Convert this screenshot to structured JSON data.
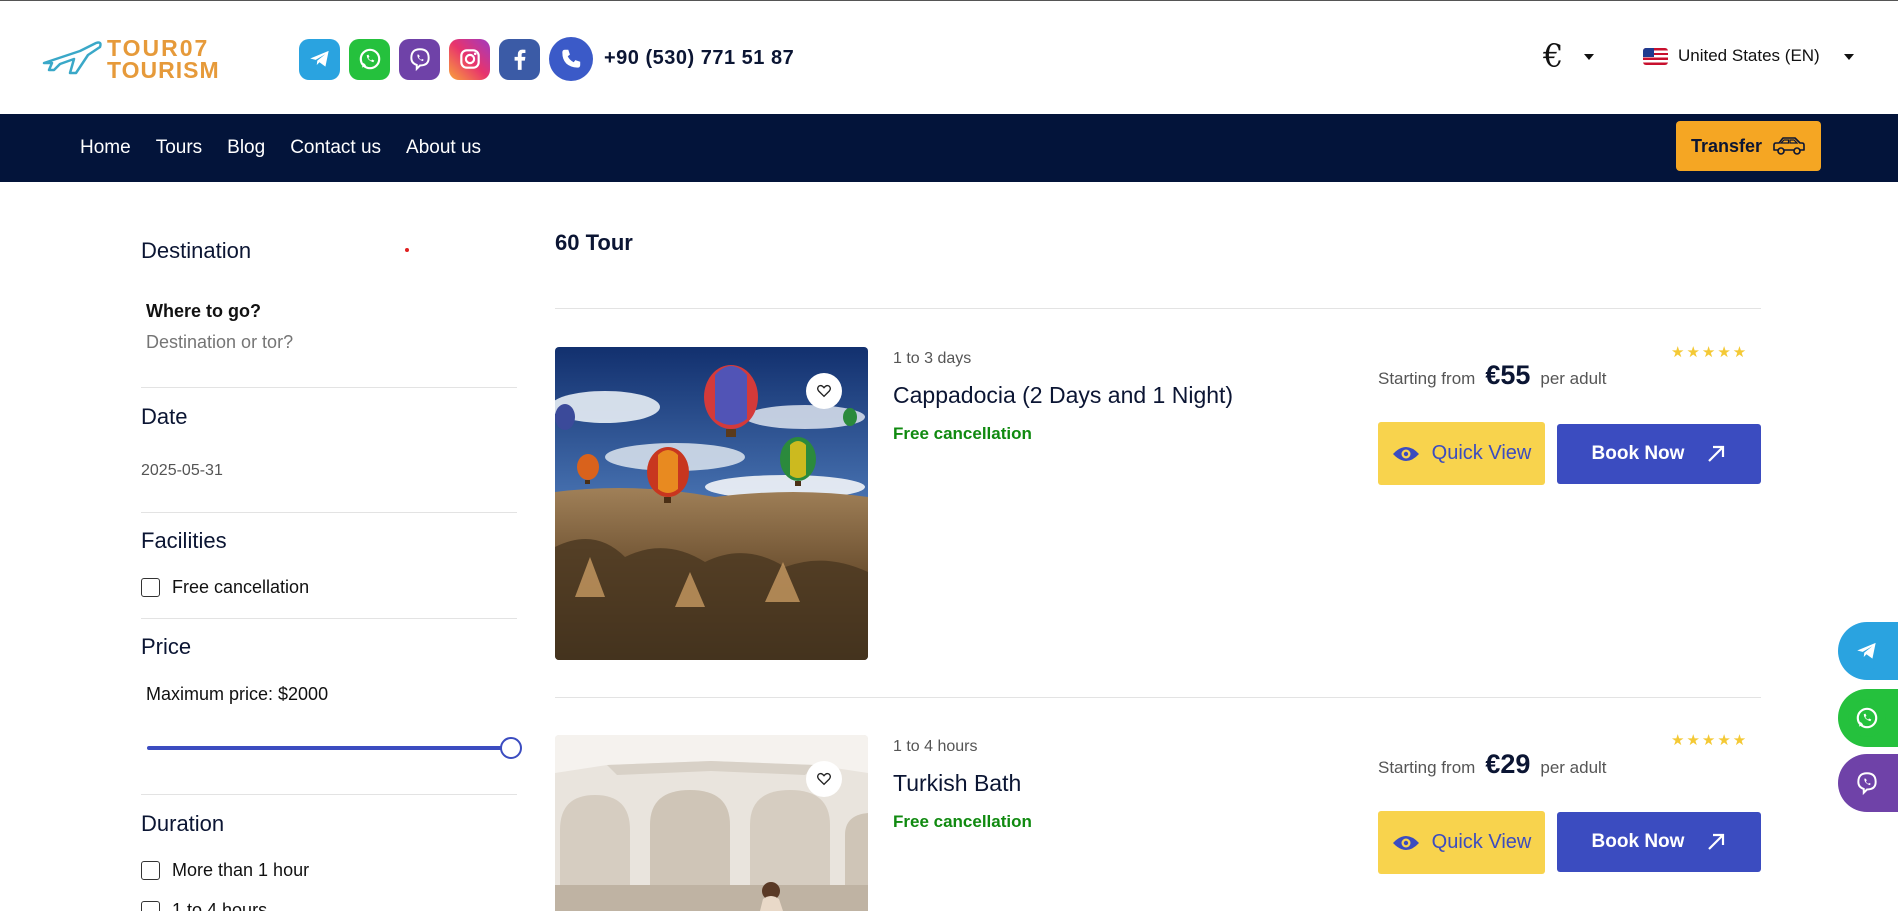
{
  "header": {
    "logo_line1": "TOUR07",
    "logo_line2": "TOURISM",
    "phone": "+90 (530) 771 51 87",
    "currency": "€",
    "language": "United States (EN)"
  },
  "social_icons": [
    "telegram-icon",
    "whatsapp-icon",
    "viber-icon",
    "instagram-icon",
    "facebook-icon",
    "phone-icon"
  ],
  "nav": {
    "links": [
      "Home",
      "Tours",
      "Blog",
      "Contact us",
      "About us"
    ],
    "transfer_label": "Transfer"
  },
  "filters": {
    "destination": {
      "title": "Destination",
      "label": "Where to go?",
      "placeholder": "Destination or tor?"
    },
    "date": {
      "title": "Date",
      "value": "2025-05-31"
    },
    "facilities": {
      "title": "Facilities",
      "options": [
        "Free cancellation"
      ]
    },
    "price": {
      "title": "Price",
      "max_label": "Maximum price: $2000",
      "slider_fraction": 1.0
    },
    "duration": {
      "title": "Duration",
      "options": [
        "More than 1 hour",
        "1 to 4 hours"
      ]
    }
  },
  "results": {
    "count_label": "60 Tour",
    "tours": [
      {
        "duration": "1 to 3 days",
        "title": "Cappadocia (2 Days and 1 Night)",
        "cancellation": "Free cancellation",
        "starting_label": "Starting from",
        "price": "€55",
        "per": "per adult",
        "stars": "★★★★★",
        "rating": 5,
        "quick_view": "Quick View",
        "book_now": "Book Now"
      },
      {
        "duration": "1 to 4 hours",
        "title": "Turkish Bath",
        "cancellation": "Free cancellation",
        "starting_label": "Starting from",
        "price": "€29",
        "per": "per adult",
        "stars": "★★★★★",
        "rating": 5,
        "quick_view": "Quick View",
        "book_now": "Book Now"
      }
    ]
  },
  "colors": {
    "nav_bg": "#03143a",
    "accent_blue": "#3b4cc0",
    "transfer_orange": "#f5a623",
    "quick_view_yellow": "#f8d34d",
    "free_cancel_green": "#108a10"
  }
}
